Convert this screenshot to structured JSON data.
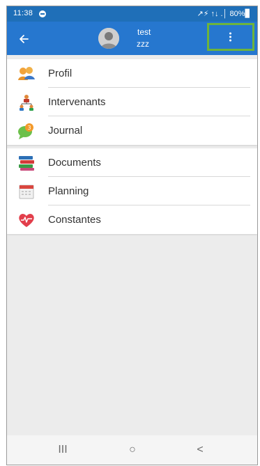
{
  "status_bar": {
    "time": "11:38",
    "system": "↗⚡ ↑↓ .│ 80%▊"
  },
  "app_bar": {
    "back_icon": "arrow-left-icon",
    "user_name": "test",
    "user_subtitle": "zzz",
    "more_icon": "more-vertical-icon",
    "highlight_color": "#6db43b",
    "bar_color": "#2677cf"
  },
  "menu_group_1": [
    {
      "label": "Profil",
      "icon": "profile-people-icon"
    },
    {
      "label": "Intervenants",
      "icon": "team-hierarchy-icon"
    },
    {
      "label": "Journal",
      "icon": "journal-chat-badge-icon",
      "badge": "3"
    }
  ],
  "menu_group_2": [
    {
      "label": "Documents",
      "icon": "books-icon"
    },
    {
      "label": "Planning",
      "icon": "calendar-icon"
    },
    {
      "label": "Constantes",
      "icon": "heart-pulse-icon"
    }
  ],
  "nav_bar": {
    "recent_label": "III",
    "home_label": "○",
    "back_label": "<"
  }
}
